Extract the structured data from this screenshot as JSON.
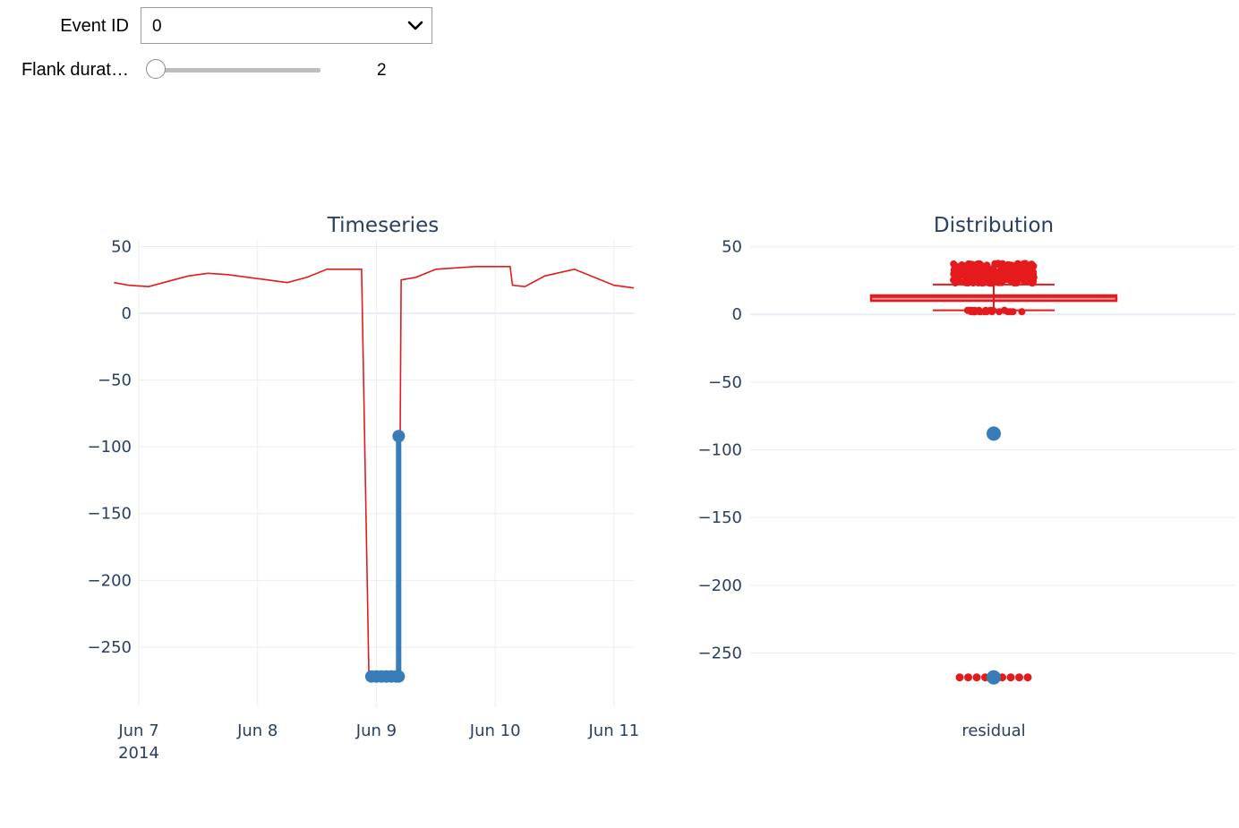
{
  "controls": {
    "event_id": {
      "label": "Event ID",
      "value": "0"
    },
    "flank_duration": {
      "label": "Flank durat…",
      "value": "2",
      "level": 0.0
    }
  },
  "icons": {
    "dropdown": "chevron-down-icon"
  },
  "colors": {
    "series": "#e41a1c",
    "highlight": "#377eb8",
    "grid": "#e9edf5",
    "text": "#2a3f5f"
  },
  "chart_data": [
    {
      "type": "line",
      "title": "Timeseries",
      "xlabel": "",
      "ylabel": "",
      "ylim": [
        -295,
        55
      ],
      "xlim": [
        "2014-06-07",
        "2014-06-11T04:00"
      ],
      "x_ticks": [
        {
          "date": "2014-06-07",
          "label": "Jun 7",
          "sublabel": "2014"
        },
        {
          "date": "2014-06-08",
          "label": "Jun 8",
          "sublabel": ""
        },
        {
          "date": "2014-06-09",
          "label": "Jun 9",
          "sublabel": ""
        },
        {
          "date": "2014-06-10",
          "label": "Jun 10",
          "sublabel": ""
        },
        {
          "date": "2014-06-11",
          "label": "Jun 11",
          "sublabel": ""
        }
      ],
      "y_ticks": [
        50,
        0,
        -50,
        -100,
        -150,
        -200,
        -250
      ],
      "series": [
        {
          "color": "#e41a1c",
          "x": [
            "2014-06-06T19:00",
            "2014-06-06T22:00",
            "2014-06-07T02:00",
            "2014-06-07T06:00",
            "2014-06-07T10:00",
            "2014-06-07T14:00",
            "2014-06-07T18:00",
            "2014-06-07T22:00",
            "2014-06-08T02:00",
            "2014-06-08T06:00",
            "2014-06-08T10:00",
            "2014-06-08T14:00",
            "2014-06-08T18:00",
            "2014-06-08T21:00",
            "2014-06-08T22:30",
            "2014-06-09T04:30",
            "2014-06-09T05:00",
            "2014-06-09T08:00",
            "2014-06-09T12:00",
            "2014-06-09T20:00",
            "2014-06-10T03:00",
            "2014-06-10T03:30",
            "2014-06-10T06:00",
            "2014-06-10T10:00",
            "2014-06-10T16:00",
            "2014-06-10T20:00",
            "2014-06-11T00:00",
            "2014-06-11T04:00"
          ],
          "y": [
            23,
            21,
            20,
            24,
            28,
            30,
            29,
            27,
            25,
            23,
            27,
            33,
            33,
            33,
            -272,
            -272,
            25,
            27,
            33,
            35,
            35,
            21,
            20,
            28,
            33,
            27,
            21,
            19
          ]
        },
        {
          "color": "#377eb8",
          "x": [
            "2014-06-08T23:00",
            "2014-06-09T00:00",
            "2014-06-09T01:00",
            "2014-06-09T02:00",
            "2014-06-09T03:00",
            "2014-06-09T04:00",
            "2014-06-09T04:30",
            "2014-06-09T04:30"
          ],
          "y": [
            -272,
            -272,
            -272,
            -272,
            -272,
            -272,
            -272,
            -92
          ]
        }
      ]
    },
    {
      "type": "box",
      "title": "Distribution",
      "xlabel": "",
      "ylabel": "",
      "categories": [
        "residual"
      ],
      "ylim": [
        -290,
        55
      ],
      "y_ticks": [
        50,
        0,
        -50,
        -100,
        -150,
        -200,
        -250
      ],
      "box": {
        "q1": 11,
        "median": 13,
        "q3": 14,
        "lower_fence": 3,
        "upper_fence": 22
      },
      "outliers_high_range": [
        23,
        38
      ],
      "outliers_low": [
        2,
        2,
        3,
        2,
        3
      ],
      "outliers_extreme": [
        -268,
        -268,
        -268,
        -268,
        -268,
        -268,
        -268,
        -268,
        -268
      ],
      "highlight_points": [
        -88,
        -268
      ],
      "colors": {
        "box": "#e41a1c",
        "highlight": "#377eb8"
      }
    }
  ]
}
